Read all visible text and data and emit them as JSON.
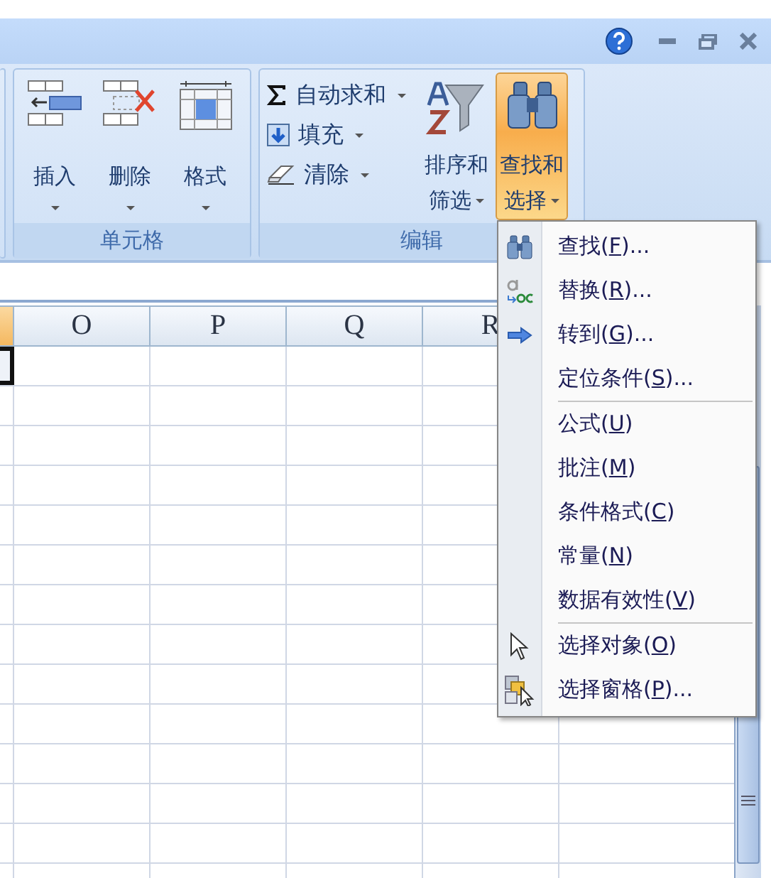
{
  "ribbon": {
    "groups": [
      {
        "label": "单元格",
        "buttons": [
          {
            "kind": "large",
            "label": "插入",
            "dropdown": true,
            "pressed": false
          },
          {
            "kind": "large",
            "label": "删除",
            "dropdown": true,
            "pressed": false
          },
          {
            "kind": "large",
            "label": "格式",
            "dropdown": true,
            "pressed": false
          }
        ]
      },
      {
        "label": "编辑",
        "buttons": [
          {
            "kind": "small",
            "label": "自动求和",
            "dropdown": true,
            "pressed": false
          },
          {
            "kind": "small",
            "label": "填充",
            "dropdown": true,
            "pressed": false
          },
          {
            "kind": "small",
            "label": "清除",
            "dropdown": true,
            "pressed": false
          },
          {
            "kind": "large",
            "label": "排序和筛选",
            "dropdown": true,
            "pressed": false
          },
          {
            "kind": "large",
            "label": "查找和选择",
            "dropdown": true,
            "pressed": true
          }
        ]
      }
    ]
  },
  "sheet": {
    "columns": [
      {
        "selected": true
      },
      {
        "label": "O",
        "selected": false
      },
      {
        "label": "P",
        "selected": false
      },
      {
        "label": "Q",
        "selected": false
      },
      {
        "label": "R",
        "selected": false
      }
    ]
  },
  "menu": {
    "sections": [
      [
        {
          "text": "查找(",
          "key": "F",
          "tail": ")..."
        },
        {
          "text": "替换(",
          "key": "R",
          "tail": ")..."
        },
        {
          "text": "转到(",
          "key": "G",
          "tail": ")..."
        },
        {
          "text": "定位条件(",
          "key": "S",
          "tail": ")..."
        }
      ],
      [
        {
          "text": "公式(",
          "key": "U",
          "tail": ")"
        },
        {
          "text": "批注(",
          "key": "M",
          "tail": ")"
        },
        {
          "text": "条件格式(",
          "key": "C",
          "tail": ")"
        },
        {
          "text": "常量(",
          "key": "N",
          "tail": ")"
        },
        {
          "text": "数据有效性(",
          "key": "V",
          "tail": ")"
        }
      ],
      [
        {
          "text": "选择对象(",
          "key": "O",
          "tail": ")"
        },
        {
          "text": "选择窗格(",
          "key": "P",
          "tail": ")..."
        }
      ]
    ]
  }
}
